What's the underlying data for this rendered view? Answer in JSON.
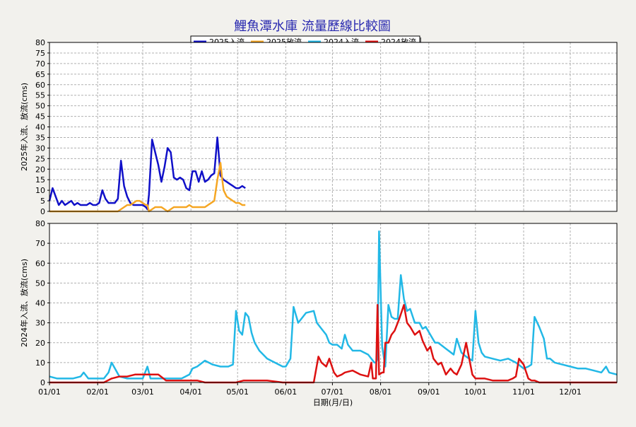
{
  "title": "鯉魚潭水庫 流量歷線比較圖",
  "legend": [
    {
      "label": "2025入流",
      "color": "#1010c8"
    },
    {
      "label": "2025放流",
      "color": "#f5a623"
    },
    {
      "label": "2024入流",
      "color": "#22b8e6"
    },
    {
      "label": "2024放流",
      "color": "#dd1111"
    }
  ],
  "chart_data": [
    {
      "type": "line",
      "ylabel": "2025年入流、放流(cms)",
      "ylim": [
        0,
        80
      ],
      "yticks": [
        0,
        5,
        10,
        15,
        20,
        25,
        30,
        35,
        40,
        45,
        50,
        55,
        60,
        65,
        70,
        75,
        80
      ],
      "xlim": [
        0,
        365
      ],
      "grid": true,
      "series": [
        {
          "name": "2025入流",
          "color": "#1010c8",
          "x": [
            0,
            2,
            4,
            6,
            8,
            10,
            12,
            14,
            16,
            18,
            20,
            22,
            24,
            26,
            28,
            30,
            32,
            34,
            36,
            38,
            40,
            42,
            44,
            46,
            48,
            50,
            52,
            54,
            56,
            58,
            60,
            62,
            63,
            64,
            66,
            68,
            70,
            72,
            74,
            76,
            78,
            80,
            82,
            84,
            86,
            88,
            90,
            92,
            94,
            96,
            98,
            100,
            102,
            104,
            106,
            108,
            110,
            111,
            112,
            114,
            116,
            118,
            120,
            122,
            124,
            126
          ],
          "values": [
            5,
            11,
            7,
            3,
            5,
            3,
            4,
            5,
            3,
            4,
            3,
            3,
            3,
            4,
            3,
            3,
            4,
            10,
            6,
            4,
            4,
            4,
            6,
            24,
            12,
            7,
            4,
            3,
            3,
            3,
            3,
            2,
            1,
            8,
            34,
            28,
            22,
            14,
            21,
            30,
            28,
            16,
            15,
            16,
            15,
            11,
            10,
            19,
            19,
            14,
            19,
            14,
            15,
            17,
            18,
            35,
            17,
            16,
            15,
            14,
            13,
            12,
            11,
            11,
            12,
            11
          ]
        },
        {
          "name": "2025放流",
          "color": "#f5a623",
          "x": [
            0,
            10,
            20,
            30,
            40,
            44,
            46,
            48,
            50,
            52,
            54,
            56,
            58,
            60,
            62,
            63,
            64,
            66,
            68,
            70,
            72,
            74,
            76,
            78,
            80,
            82,
            84,
            86,
            88,
            90,
            92,
            94,
            96,
            98,
            100,
            102,
            104,
            106,
            108,
            110,
            111,
            112,
            114,
            116,
            118,
            120,
            122,
            124,
            126
          ],
          "values": [
            0,
            0,
            0,
            0,
            0,
            0,
            1,
            2,
            3,
            3,
            4,
            5,
            5,
            4,
            3,
            3,
            0,
            1,
            2,
            2,
            2,
            1,
            0,
            1,
            2,
            2,
            2,
            2,
            2,
            3,
            2,
            2,
            2,
            2,
            2,
            3,
            4,
            5,
            15,
            23,
            16,
            10,
            7,
            6,
            5,
            4,
            4,
            3,
            3
          ]
        }
      ]
    },
    {
      "type": "line",
      "ylabel": "2024年入流、放流(cms)",
      "xlabel": "日期(月/日)",
      "ylim": [
        0,
        80
      ],
      "yticks": [
        0,
        10,
        20,
        30,
        40,
        50,
        60,
        70,
        80
      ],
      "xlim": [
        0,
        365
      ],
      "xticks": [
        {
          "v": 0,
          "label": "01/01"
        },
        {
          "v": 31,
          "label": "02/01"
        },
        {
          "v": 60,
          "label": "03/01"
        },
        {
          "v": 91,
          "label": "04/01"
        },
        {
          "v": 121,
          "label": "05/01"
        },
        {
          "v": 152,
          "label": "06/01"
        },
        {
          "v": 182,
          "label": "07/01"
        },
        {
          "v": 213,
          "label": "08/01"
        },
        {
          "v": 244,
          "label": "09/01"
        },
        {
          "v": 274,
          "label": "10/01"
        },
        {
          "v": 305,
          "label": "11/01"
        },
        {
          "v": 335,
          "label": "12/01"
        }
      ],
      "grid": true,
      "series": [
        {
          "name": "2024入流",
          "color": "#22b8e6",
          "x": [
            0,
            5,
            10,
            15,
            20,
            22,
            25,
            30,
            35,
            38,
            40,
            45,
            50,
            55,
            60,
            63,
            65,
            70,
            75,
            80,
            85,
            90,
            92,
            95,
            100,
            105,
            110,
            115,
            118,
            120,
            122,
            124,
            126,
            128,
            130,
            132,
            135,
            140,
            145,
            150,
            152,
            155,
            157,
            160,
            165,
            170,
            172,
            175,
            178,
            180,
            182,
            185,
            188,
            190,
            192,
            195,
            200,
            205,
            208,
            209,
            210,
            211,
            212,
            214,
            216,
            218,
            220,
            222,
            224,
            226,
            228,
            230,
            232,
            235,
            238,
            240,
            242,
            245,
            248,
            250,
            255,
            260,
            262,
            265,
            268,
            270,
            272,
            274,
            276,
            278,
            280,
            285,
            290,
            295,
            300,
            305,
            308,
            310,
            312,
            315,
            318,
            320,
            322,
            325,
            330,
            335,
            340,
            345,
            350,
            355,
            358,
            360,
            365
          ],
          "values": [
            3,
            2,
            2,
            2,
            3,
            5,
            2,
            2,
            2,
            5,
            10,
            3,
            2,
            2,
            2,
            8,
            2,
            2,
            2,
            2,
            2,
            4,
            7,
            8,
            11,
            9,
            8,
            8,
            9,
            36,
            26,
            24,
            35,
            33,
            25,
            20,
            16,
            12,
            10,
            8,
            8,
            12,
            38,
            30,
            35,
            36,
            30,
            27,
            24,
            20,
            19,
            19,
            17,
            24,
            19,
            16,
            16,
            14,
            11,
            10,
            10,
            12,
            76,
            18,
            8,
            39,
            33,
            32,
            32,
            54,
            42,
            36,
            37,
            30,
            30,
            27,
            28,
            24,
            20,
            20,
            17,
            14,
            22,
            15,
            13,
            12,
            11,
            36,
            20,
            15,
            13,
            12,
            11,
            12,
            10,
            7,
            8,
            9,
            33,
            28,
            22,
            12,
            12,
            10,
            9,
            8,
            7,
            7,
            6,
            5,
            8,
            5,
            4
          ]
        },
        {
          "name": "2024放流",
          "color": "#dd1111",
          "x": [
            0,
            30,
            35,
            40,
            45,
            50,
            55,
            60,
            65,
            70,
            75,
            80,
            85,
            90,
            95,
            100,
            110,
            120,
            125,
            130,
            140,
            150,
            160,
            165,
            170,
            173,
            175,
            178,
            180,
            183,
            185,
            188,
            190,
            195,
            200,
            205,
            207,
            208,
            209,
            210,
            211,
            212,
            214,
            215,
            216,
            218,
            220,
            222,
            225,
            228,
            230,
            232,
            235,
            238,
            240,
            243,
            245,
            247,
            250,
            252,
            255,
            258,
            260,
            262,
            265,
            268,
            270,
            272,
            274,
            276,
            278,
            280,
            285,
            290,
            295,
            298,
            300,
            302,
            305,
            308,
            310,
            312,
            315,
            320,
            330,
            365
          ],
          "values": [
            0,
            0,
            0,
            2,
            3,
            3,
            4,
            4,
            4,
            4,
            1,
            1,
            1,
            1,
            1,
            0,
            0,
            0,
            1,
            1,
            1,
            0,
            0,
            0,
            0,
            13,
            10,
            8,
            12,
            5,
            3,
            4,
            5,
            6,
            4,
            3,
            10,
            2,
            2,
            2,
            39,
            4,
            5,
            5,
            20,
            20,
            24,
            26,
            32,
            39,
            30,
            28,
            24,
            26,
            21,
            16,
            18,
            12,
            9,
            10,
            4,
            7,
            5,
            4,
            9,
            20,
            12,
            4,
            2,
            2,
            2,
            2,
            1,
            1,
            1,
            2,
            3,
            12,
            9,
            2,
            1,
            1,
            0,
            0,
            0,
            0
          ]
        }
      ]
    }
  ]
}
